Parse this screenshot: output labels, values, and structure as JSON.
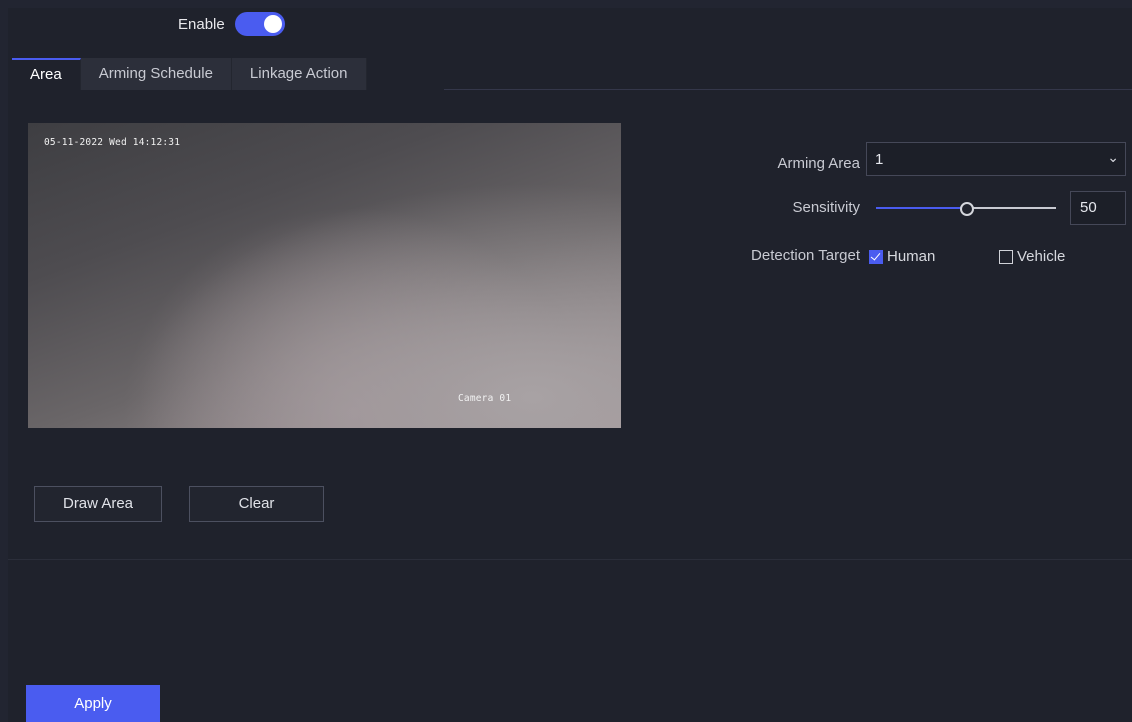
{
  "header": {
    "enable_label": "Enable",
    "enable_on": true
  },
  "tabs": [
    {
      "label": "Area",
      "active": true
    },
    {
      "label": "Arming Schedule",
      "active": false
    },
    {
      "label": "Linkage Action",
      "active": false
    }
  ],
  "preview": {
    "timestamp": "05-11-2022 Wed 14:12:31",
    "camera_name": "Camera 01"
  },
  "actions": {
    "draw_area": "Draw Area",
    "clear": "Clear"
  },
  "settings": {
    "arming_area": {
      "label": "Arming Area",
      "value": "1"
    },
    "sensitivity": {
      "label": "Sensitivity",
      "value": "50",
      "fraction": 0.5
    },
    "detection_target": {
      "label": "Detection Target",
      "options": [
        {
          "label": "Human",
          "checked": true
        },
        {
          "label": "Vehicle",
          "checked": false
        }
      ]
    }
  },
  "footer": {
    "apply": "Apply"
  },
  "colors": {
    "accent": "#4a5cf0",
    "background": "#1f222c"
  },
  "icons": {
    "dropdown": "chevron-down-icon"
  }
}
